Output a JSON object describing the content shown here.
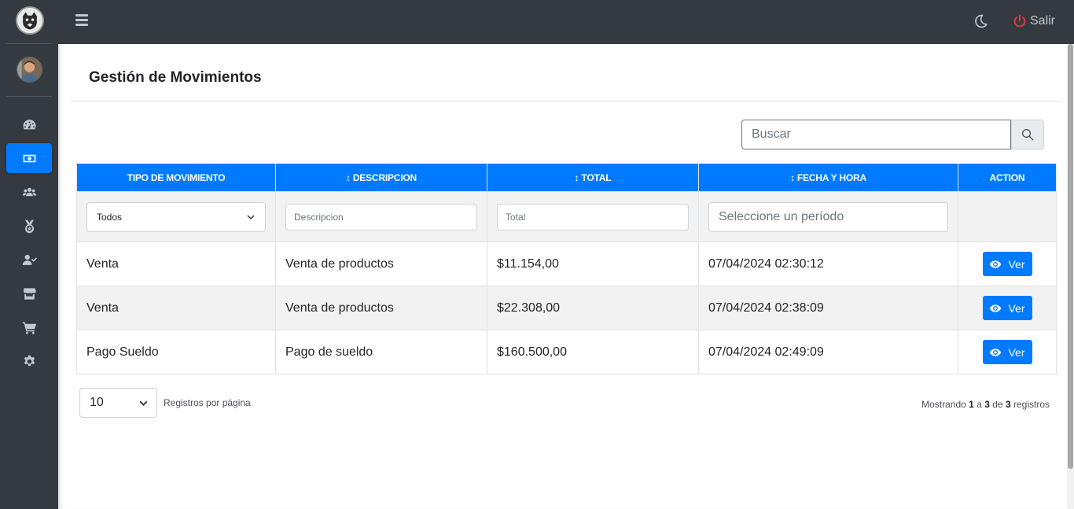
{
  "sidebar": {
    "logo": "panther-logo",
    "avatar": "user-avatar",
    "items": [
      {
        "icon": "dashboard-icon",
        "active": false
      },
      {
        "icon": "money-bill-icon",
        "active": true
      },
      {
        "icon": "users-icon",
        "active": false
      },
      {
        "icon": "medal-icon",
        "active": false
      },
      {
        "icon": "user-check-icon",
        "active": false
      },
      {
        "icon": "store-icon",
        "active": false
      },
      {
        "icon": "cart-icon",
        "active": false
      },
      {
        "icon": "gear-icon",
        "active": false
      }
    ]
  },
  "topbar": {
    "menu_icon": "hamburger-icon",
    "theme_icon": "moon-icon",
    "logout_label": "Salir"
  },
  "page": {
    "title": "Gestión de Movimientos"
  },
  "search": {
    "placeholder": "Buscar"
  },
  "table": {
    "columns": [
      "TIPO DE MOVIMIENTO",
      "DESCRIPCION",
      "TOTAL",
      "FECHA Y HORA",
      "ACTION"
    ],
    "sort_glyph": "↕",
    "filters": {
      "tipo_value": "Todos",
      "descripcion_placeholder": "Descripcion",
      "total_placeholder": "Total",
      "fecha_placeholder": "Seleccione un período"
    },
    "action_label": "Ver",
    "rows": [
      {
        "tipo": "Venta",
        "descripcion": "Venta de productos",
        "total": "$11.154,00",
        "fecha": "07/04/2024 02:30:12"
      },
      {
        "tipo": "Venta",
        "descripcion": "Venta de productos",
        "total": "$22.308,00",
        "fecha": "07/04/2024 02:38:09"
      },
      {
        "tipo": "Pago Sueldo",
        "descripcion": "Pago de sueldo",
        "total": "$160.500,00",
        "fecha": "07/04/2024 02:49:09"
      }
    ]
  },
  "footer": {
    "per_page_value": "10",
    "per_page_label": "Registros por página",
    "showing_prefix": "Mostrando",
    "from": "1",
    "a": "a",
    "to": "3",
    "de": "de",
    "total": "3",
    "suffix": "registros"
  },
  "colors": {
    "sidebar_bg": "#343a40",
    "accent": "#007bff",
    "logout_icon": "#dc3545"
  }
}
